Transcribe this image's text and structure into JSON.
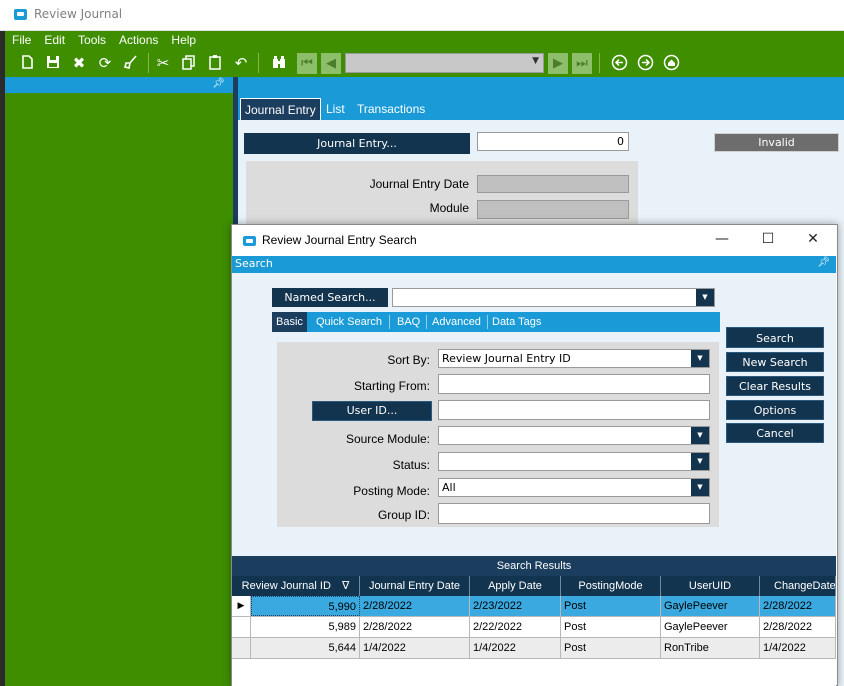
{
  "window": {
    "title": "Review Journal"
  },
  "menu": [
    "File",
    "Edit",
    "Tools",
    "Actions",
    "Help"
  ],
  "toolbar": {
    "icons": [
      "new-icon",
      "save-icon",
      "delete-icon",
      "refresh-icon",
      "clear-icon",
      "cut-icon",
      "copy-icon",
      "paste-icon",
      "undo-icon",
      "binoculars-icon",
      "first-icon",
      "prev-icon",
      "next-icon",
      "last-icon",
      "back-icon",
      "forward-icon",
      "home-icon"
    ],
    "combo_value": ""
  },
  "main_tabs": [
    {
      "label": "Journal Entry",
      "active": true
    },
    {
      "label": "List",
      "active": false
    },
    {
      "label": "Transactions",
      "active": false
    }
  ],
  "journal_entry": {
    "button_label": "Journal Entry...",
    "value": "0",
    "status": "Invalid",
    "date_label": "Journal Entry Date",
    "module_label": "Module"
  },
  "dialog": {
    "title": "Review Journal Entry Search",
    "section": "Search",
    "named_search_label": "Named Search...",
    "named_search_value": "",
    "tabs": [
      {
        "label": "Basic",
        "active": true
      },
      {
        "label": "Quick Search",
        "active": false
      },
      {
        "label": "BAQ",
        "active": false
      },
      {
        "label": "Advanced",
        "active": false
      },
      {
        "label": "Data Tags",
        "active": false
      }
    ],
    "fields": {
      "sort_by_label": "Sort By:",
      "sort_by_value": "Review Journal Entry ID",
      "starting_from_label": "Starting From:",
      "starting_from_value": "",
      "user_id_button": "User ID...",
      "user_id_value": "",
      "source_module_label": "Source Module:",
      "source_module_value": "",
      "status_label": "Status:",
      "status_value": "",
      "posting_mode_label": "Posting Mode:",
      "posting_mode_value": "All",
      "group_id_label": "Group ID:",
      "group_id_value": ""
    },
    "buttons": {
      "search": "Search",
      "new_search": "New Search",
      "clear_results": "Clear Results",
      "options": "Options",
      "cancel": "Cancel"
    },
    "results": {
      "title": "Search Results",
      "columns": [
        "Review Journal ID",
        "Journal Entry Date",
        "Apply Date",
        "PostingMode",
        "UserUID",
        "ChangeDate"
      ],
      "sort_indicator": "∇",
      "rows": [
        {
          "id": "5,990",
          "je_date": "2/28/2022",
          "apply_date": "2/23/2022",
          "mode": "Post",
          "user": "GaylePeever",
          "change": "2/28/2022",
          "selected": true
        },
        {
          "id": "5,989",
          "je_date": "2/28/2022",
          "apply_date": "2/22/2022",
          "mode": "Post",
          "user": "GaylePeever",
          "change": "2/28/2022",
          "selected": false
        },
        {
          "id": "5,644",
          "je_date": "1/4/2022",
          "apply_date": "1/4/2022",
          "mode": "Post",
          "user": "RonTribe",
          "change": "1/4/2022",
          "selected": false
        }
      ]
    }
  },
  "colors": {
    "green": "#3e8e00",
    "blue": "#1a9bd7",
    "navy": "#13344f",
    "selected_row": "#3aa9e0"
  }
}
